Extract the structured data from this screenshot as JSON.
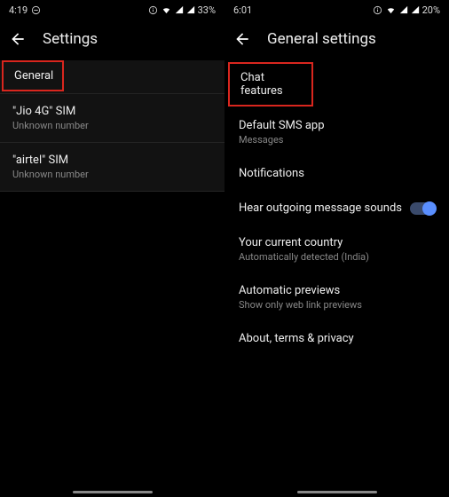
{
  "left": {
    "status": {
      "time": "4:19",
      "battery": "33%"
    },
    "appbar": {
      "title": "Settings"
    },
    "items": [
      {
        "title": "General",
        "sub": "",
        "highlight": true
      },
      {
        "title": "\"Jio 4G\" SIM",
        "sub": "Unknown number"
      },
      {
        "title": "\"airtel\" SIM",
        "sub": "Unknown number"
      }
    ]
  },
  "right": {
    "status": {
      "time": "6:01",
      "battery": "20%"
    },
    "appbar": {
      "title": "General settings"
    },
    "items": [
      {
        "title": "Chat features",
        "sub": "",
        "highlight": true
      },
      {
        "title": "Default SMS app",
        "sub": "Messages"
      },
      {
        "title": "Notifications",
        "sub": ""
      },
      {
        "title": "Hear outgoing message sounds",
        "sub": "",
        "toggle": true
      },
      {
        "title": "Your current country",
        "sub": "Automatically detected (India)"
      },
      {
        "title": "Automatic previews",
        "sub": "Show only web link previews"
      },
      {
        "title": "About, terms & privacy",
        "sub": ""
      }
    ]
  }
}
